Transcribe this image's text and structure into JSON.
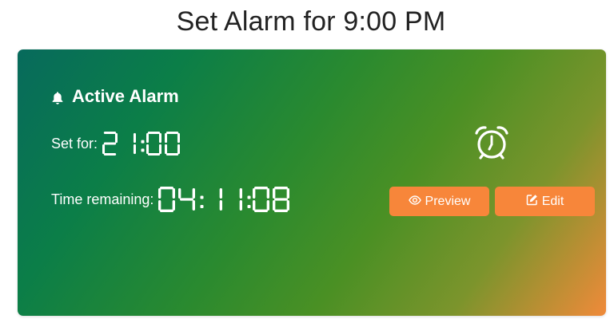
{
  "page": {
    "title": "Set Alarm for 9:00 PM"
  },
  "card": {
    "heading": "Active Alarm",
    "set_for_label": "Set for:",
    "set_for_value": "21:00",
    "remaining_label": "Time remaining:",
    "remaining_value": "04:11:08",
    "preview_label": "Preview",
    "edit_label": "Edit",
    "icons": {
      "heading": "bell-icon",
      "clock": "alarm-clock-icon",
      "preview": "eye-icon",
      "edit": "edit-icon"
    }
  },
  "colors": {
    "button": "#f7863a",
    "gradient_start": "#076a5c",
    "gradient_end": "#f08a3a"
  }
}
